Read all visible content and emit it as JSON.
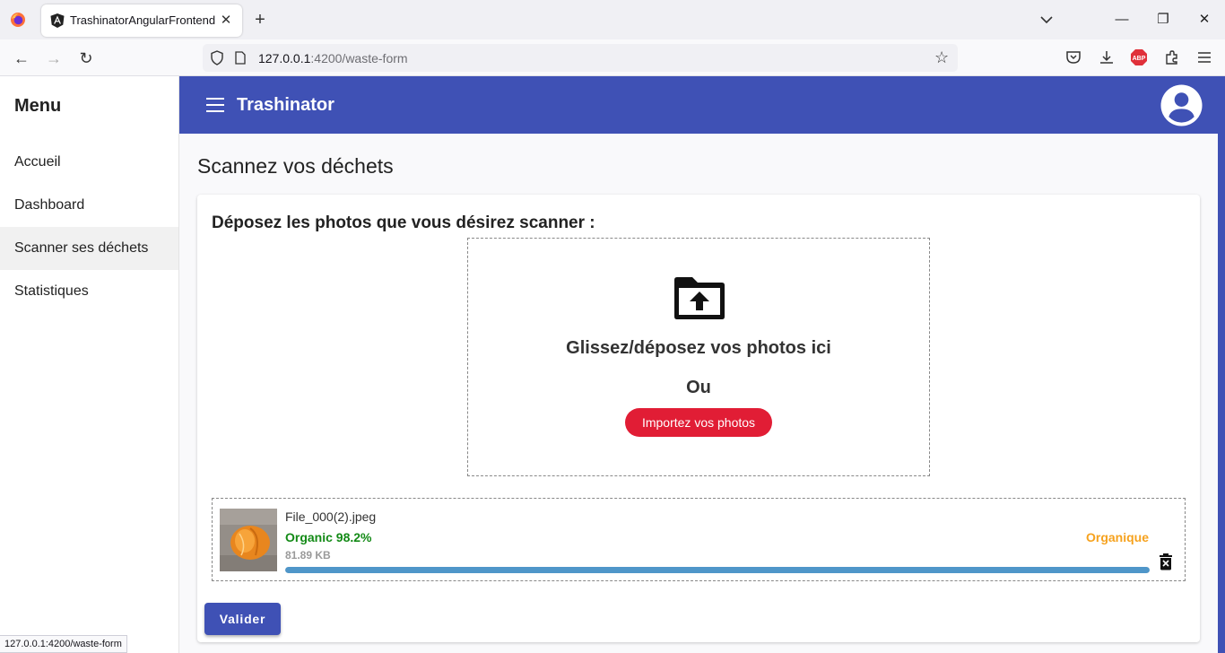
{
  "browser": {
    "tab_title": "TrashinatorAngularFrontend",
    "url_host": "127.0.0.1",
    "url_rest": ":4200/waste-form",
    "status_link": "127.0.0.1:4200/waste-form"
  },
  "sidebar": {
    "title": "Menu",
    "items": [
      {
        "label": "Accueil"
      },
      {
        "label": "Dashboard"
      },
      {
        "label": "Scanner ses déchets"
      },
      {
        "label": "Statistiques"
      }
    ]
  },
  "header": {
    "title": "Trashinator"
  },
  "main": {
    "page_title": "Scannez vos déchets",
    "card_heading": "Déposez les photos que vous désirez scanner :",
    "dropzone": {
      "drop_text": "Glissez/déposez vos photos ici",
      "or_text": "Ou",
      "import_button": "Importez vos photos"
    },
    "file": {
      "name": "File_000(2).jpeg",
      "classification": "Organic 98.2%",
      "size": "81.89 KB",
      "category": "Organique",
      "progress": 1.0
    },
    "validate_button": "Valider"
  },
  "colors": {
    "primary": "#3f51b5",
    "accent_red": "#e11d35",
    "organic_green": "#138a16",
    "category_orange": "#f6a21e",
    "progress_blue": "#4f96c9"
  },
  "icons": {
    "browser_logo": "firefox-icon",
    "tab_favicon": "angular-icon",
    "upload": "folder-upload-icon",
    "delete": "delete-forever-icon",
    "account": "account-circle-icon"
  }
}
